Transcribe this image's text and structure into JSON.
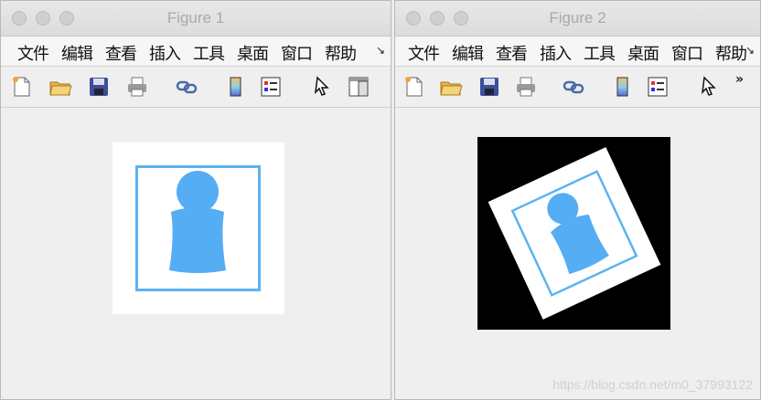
{
  "windows": [
    {
      "title": "Figure 1",
      "menu": [
        "文件",
        "编辑",
        "查看",
        "插入",
        "工具",
        "桌面",
        "窗口",
        "帮助"
      ],
      "menu_more": "↘"
    },
    {
      "title": "Figure 2",
      "menu": [
        "文件",
        "编辑",
        "查看",
        "插入",
        "工具",
        "桌面",
        "窗口",
        "帮助"
      ],
      "menu_more": "↘",
      "toolbar_more": "»"
    }
  ],
  "watermark": "https://blog.csdn.net/m0_37993122",
  "icons": [
    "new-file-icon",
    "open-folder-icon",
    "save-icon",
    "print-icon",
    "link-icon",
    "colorbar-icon",
    "legend-icon",
    "pointer-icon",
    "panel-icon"
  ],
  "colors": {
    "person_blue": "#55adf4",
    "frame_blue": "#5bb3f0",
    "black_bg": "#000000"
  }
}
